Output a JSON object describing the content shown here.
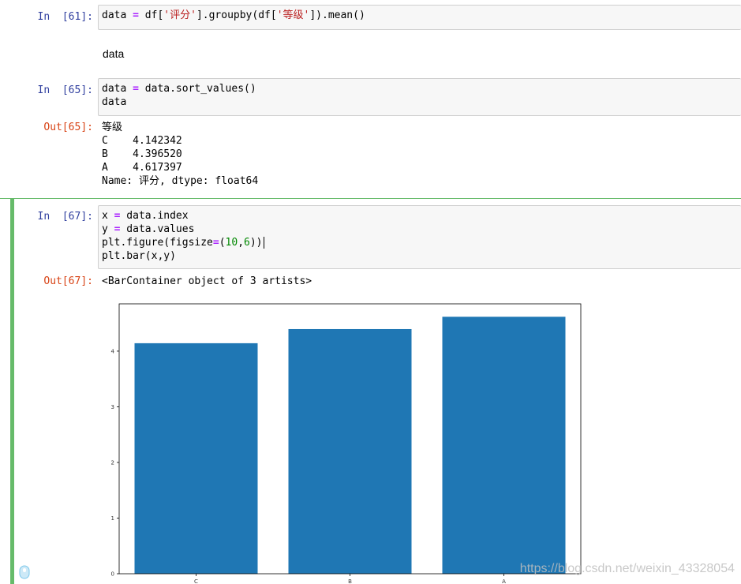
{
  "cells": {
    "c61": {
      "prompt": "In  [61]:",
      "code": {
        "part1": "data ",
        "op": "=",
        "part2": " df[",
        "str1": "'评分'",
        "part3": "].groupby(df[",
        "str2": "'等级'",
        "part4": "]).mean()"
      }
    },
    "markdown": {
      "text": "data"
    },
    "c65": {
      "prompt": "In  [65]:",
      "line1": {
        "a": "data ",
        "op": "=",
        "b": " data.sort_values()"
      },
      "line2": "data",
      "out_prompt": "Out[65]:",
      "output": "等级\nC    4.142342\nB    4.396520\nA    4.617397\nName: 评分, dtype: float64"
    },
    "c67": {
      "prompt": "In  [67]:",
      "line1": {
        "a": "x ",
        "op": "=",
        "b": " data.index"
      },
      "line2": {
        "a": "y ",
        "op": "=",
        "b": " data.values"
      },
      "line3": {
        "a": "plt.figure(figsize",
        "op": "=",
        "b": "(",
        "n1": "10",
        "c": ",",
        "n2": "6",
        "d": "))"
      },
      "line4": "plt.bar(x,y)",
      "out_prompt": "Out[67]:",
      "output": "<BarContainer object of 3 artists>"
    }
  },
  "watermark": "https://blog.csdn.net/weixin_43328054",
  "colors": {
    "bar": "#1f77b4",
    "in_prompt": "#303f9f",
    "out_prompt": "#d84315",
    "selected_cell": "#66bb6a"
  },
  "chart_data": {
    "type": "bar",
    "categories": [
      "C",
      "B",
      "A"
    ],
    "values": [
      4.142342,
      4.39652,
      4.617397
    ],
    "ylim": [
      0,
      4.85
    ],
    "yticks": [
      0,
      1,
      2,
      3,
      4
    ],
    "title": "",
    "xlabel": "",
    "ylabel": "",
    "grid": false
  }
}
